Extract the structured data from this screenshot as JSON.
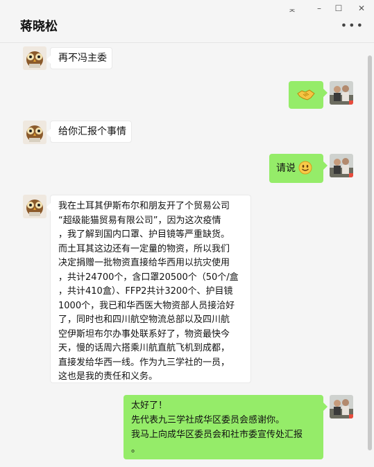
{
  "window": {
    "title": "蒋晓松",
    "controls": {
      "pin": "ᆽ",
      "minimize": "–",
      "maximize": "☐",
      "close": "✕"
    },
    "more_icon": "•••"
  },
  "messages": [
    {
      "side": "left",
      "text": "再不冯主委"
    },
    {
      "side": "right",
      "emoji": "handshake-emoji"
    },
    {
      "side": "left",
      "text": "给你汇报个事情"
    },
    {
      "side": "right",
      "text": "请说",
      "emoji": "smile-emoji"
    },
    {
      "side": "left",
      "lines": [
        "我在土耳其伊斯布尔和朋友开了个贸易公司",
        "“超级能猫贸易有限公司”，因为这次疫情",
        "，我了解到国内口罩、护目镜等严重缺货。",
        "而土耳其这边还有一定量的物资，所以我们",
        "决定捐赠一批物资直接给华西用以抗灾使用",
        "，共计24700个，含口罩20500个（50个/盒",
        "，共计410盒）、FFP2共计3200个、护目镜",
        "1000个，我已和华西医大物资部人员接洽好",
        "了，同时也和四川航空物流总部以及四川航",
        "空伊斯坦布尔办事处联系好了，物资最快今",
        "天，慢的话周六搭乘川航直航飞机到成都，",
        "直接发给华西一线。作为九三学社的一员，",
        "这也是我的责任和义务。"
      ]
    },
    {
      "side": "right",
      "lines": [
        "太好了！",
        "先代表九三学社成华区委员会感谢你。",
        "我马上向成华区委员会和社市委宣传处汇报",
        "。"
      ]
    }
  ],
  "colors": {
    "self_bubble": "#95ec69",
    "other_bubble": "#ffffff",
    "background": "#f5f5f5"
  }
}
